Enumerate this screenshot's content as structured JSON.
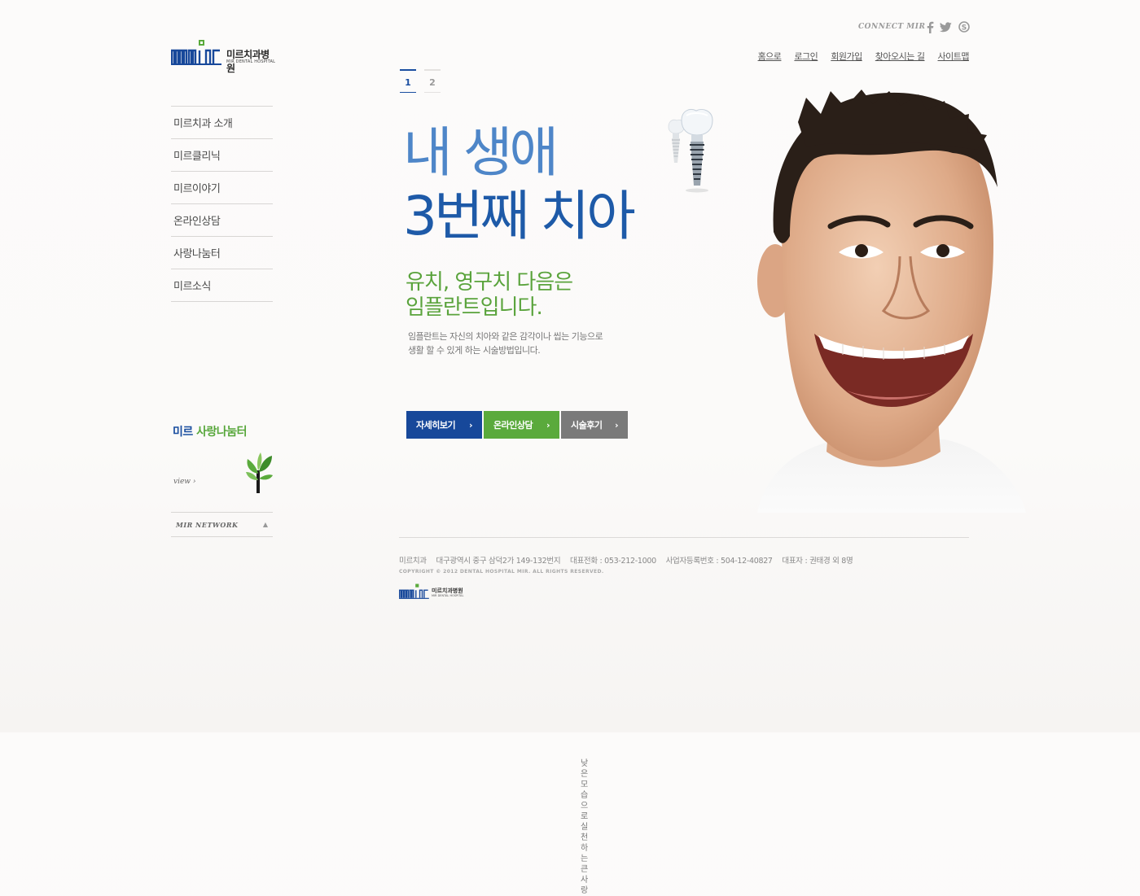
{
  "brand": {
    "name_kor": "미르치과병원",
    "name_eng": "MIR DENTAL HOSPITAL",
    "logo_text": "mir",
    "colors": {
      "blue": "#17489a",
      "green": "#5aaa3c",
      "gray": "#7a7a7a"
    }
  },
  "header": {
    "connect_label": "CONNECT MIR",
    "social": [
      {
        "name": "facebook-icon",
        "glyph": "f"
      },
      {
        "name": "twitter-icon",
        "glyph": "🐦"
      },
      {
        "name": "skype-icon",
        "glyph": "S"
      }
    ],
    "nav": [
      "홈으로",
      "로그인",
      "회원가입",
      "찾아오시는 길",
      "사이트맵"
    ]
  },
  "sidebar": {
    "items": [
      "미르치과 소개",
      "미르클리닉",
      "미르이야기",
      "온라인상담",
      "사랑나눔터",
      "미르소식"
    ],
    "promo": {
      "title_a": "미르",
      "title_b": "사랑나눔터",
      "desc_line1": "낮은 모습으로",
      "desc_line2": "실천하는 큰 사랑",
      "view_label": "view"
    },
    "network_label": "MIR NETWORK"
  },
  "pager": [
    "1",
    "2"
  ],
  "hero": {
    "headline_line1": "내 생애",
    "headline_line2": "3번째 치아",
    "sub_line1": "유치, 영구치 다음은",
    "sub_line2": "임플란트입니다.",
    "desc_line1": "임플란트는 자신의 치아와 같은 감각이나 씹는 기능으로",
    "desc_line2": "생활 할 수 있게 하는 시술방법입니다.",
    "buttons": [
      "자세히보기",
      "온라인상담",
      "시술후기"
    ]
  },
  "footer": {
    "name": "미르치과",
    "address": "대구광역시 중구 삼덕2가 149-132번지",
    "phone": "대표전화 : 053-212-1000",
    "biz_no": "사업자등록번호 : 504-12-40827",
    "ceo": "대표자 : 권태경 외 8명",
    "copyright": "COPYRIGHT © 2012 DENTAL HOSPITAL MIR. ALL RIGHTS RESERVED."
  }
}
